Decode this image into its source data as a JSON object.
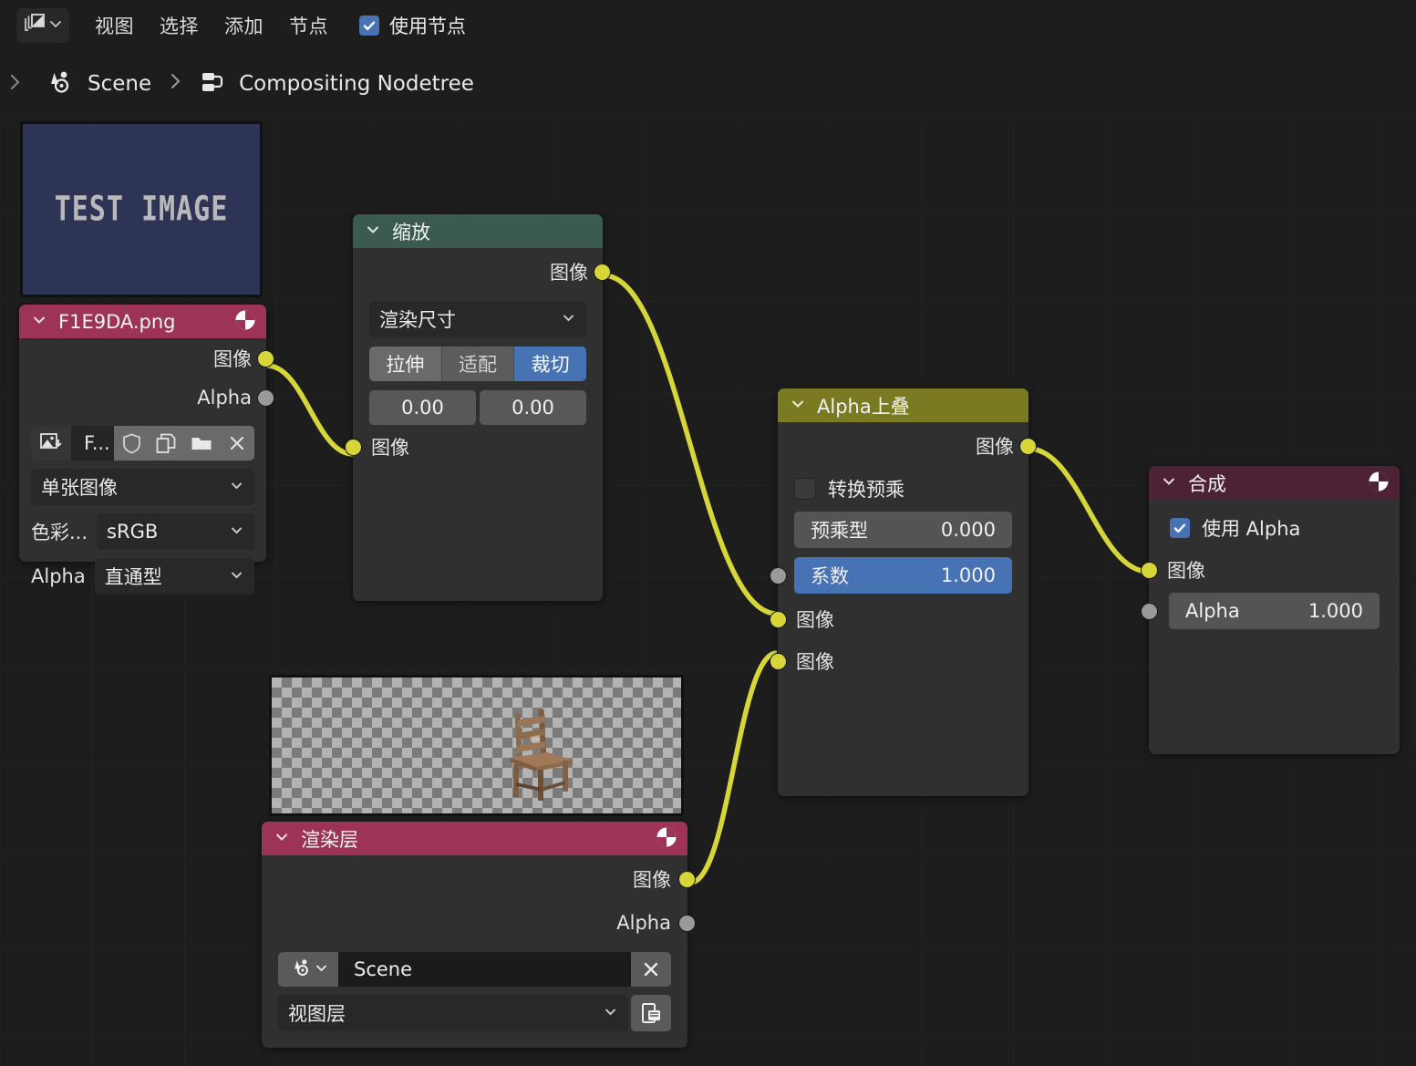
{
  "app": {
    "editor_icon": "compositor-editor-icon",
    "menus": [
      "视图",
      "选择",
      "添加",
      "节点"
    ],
    "use_nodes": {
      "label": "使用节点",
      "checked": true
    }
  },
  "breadcrumb": {
    "expand_icon": "chevron-right-icon",
    "scene_icon": "scene-icon",
    "scene": "Scene",
    "separator": "›",
    "nodetree_icon": "nodetree-icon",
    "nodetree": "Compositing Nodetree"
  },
  "nodes": {
    "image": {
      "title": "F1E9DA.png",
      "header_color": "#9e3358",
      "header_icon": "preview-sphere-icon",
      "preview_text": "TEST IMAGE",
      "preview_bg": "#2e3456",
      "outputs": [
        {
          "label": "图像",
          "color": "#d6d639"
        },
        {
          "label": "Alpha",
          "color": "#9a9a9a"
        }
      ],
      "toolbar": {
        "browse_icon": "image-browse-icon",
        "name_field": "F...",
        "fake_user_icon": "shield-icon",
        "duplicate_icon": "copy-icon",
        "open_icon": "folder-icon",
        "unlink_icon": "close-icon"
      },
      "source_dropdown": "单张图像",
      "colorspace_label": "色彩...",
      "colorspace_value": "sRGB",
      "alpha_label": "Alpha",
      "alpha_value": "直通型"
    },
    "scale": {
      "title": "缩放",
      "header_color": "#3a5a52",
      "outputs": [
        {
          "label": "图像",
          "color": "#d6d639"
        }
      ],
      "space_dropdown": "渲染尺寸",
      "fit_buttons": [
        {
          "label": "拉伸",
          "selected": false
        },
        {
          "label": "适配",
          "selected": false
        },
        {
          "label": "裁切",
          "selected": true
        }
      ],
      "offsets": [
        "0.00",
        "0.00"
      ],
      "inputs": [
        {
          "label": "图像",
          "color": "#d6d639"
        }
      ]
    },
    "alpha_over": {
      "title": "Alpha上叠",
      "header_color": "#7a7a23",
      "outputs": [
        {
          "label": "图像",
          "color": "#d6d639"
        }
      ],
      "convert_premul": {
        "label": "转换预乘",
        "checked": false
      },
      "premul_slider": {
        "label": "预乘型",
        "value": "0.000",
        "fill": 0
      },
      "fac_slider": {
        "label": "系数",
        "value": "1.000",
        "fill": 100,
        "socket_color": "#9a9a9a"
      },
      "inputs": [
        {
          "label": "图像",
          "color": "#d6d639"
        },
        {
          "label": "图像",
          "color": "#d6d639"
        }
      ]
    },
    "composite": {
      "title": "合成",
      "header_color": "#4e2235",
      "header_icon": "preview-sphere-icon",
      "use_alpha": {
        "label": "使用 Alpha",
        "checked": true
      },
      "image_input": {
        "label": "图像",
        "color": "#d6d639"
      },
      "alpha_input": {
        "label": "Alpha",
        "value": "1.000",
        "color": "#9a9a9a"
      }
    },
    "render_layers": {
      "title": "渲染层",
      "header_color": "#9e3358",
      "header_icon": "preview-sphere-icon",
      "preview_alt": "渲染结果预览 - 椅子",
      "outputs": [
        {
          "label": "图像",
          "color": "#d6d639"
        },
        {
          "label": "Alpha",
          "color": "#9a9a9a"
        }
      ],
      "scene_icon": "scene-icon",
      "scene_value": "Scene",
      "scene_clear_icon": "close-icon",
      "view_layer_value": "视图层",
      "view_layer_icon": "render-layer-icon"
    }
  },
  "theme": {
    "noodle_color": "#d6d639",
    "canvas_bg": "#1d1d1d",
    "node_bg": "#303030",
    "accent_blue": "#4772b3"
  }
}
